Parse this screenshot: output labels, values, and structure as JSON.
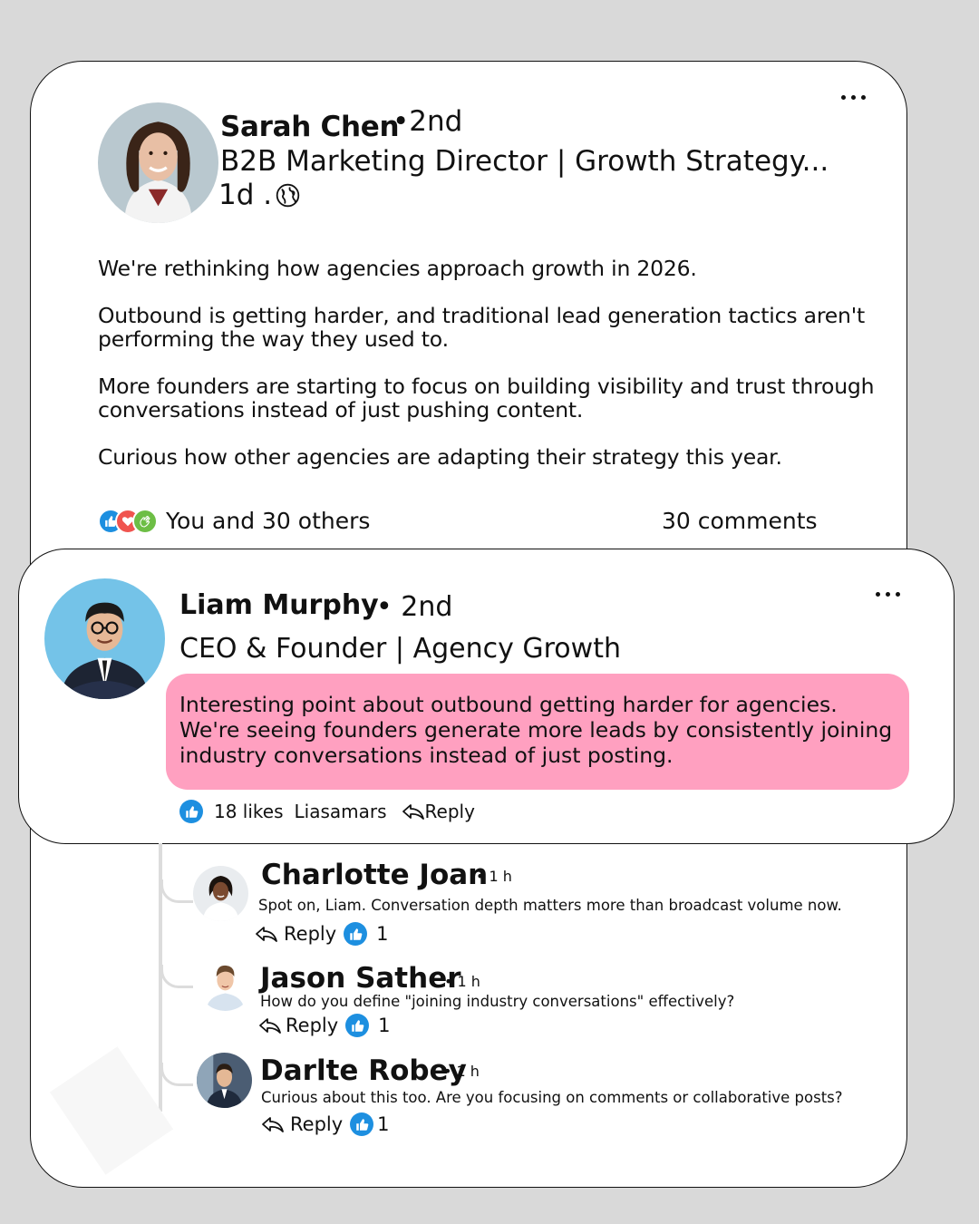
{
  "post": {
    "author_name": "Sarah Chen",
    "degree": "•2nd",
    "headline": "B2B Marketing Director | Growth Strategy...",
    "time": "1d .",
    "body": [
      "We're rethinking how agencies approach growth in 2026.",
      "Outbound is getting harder, and traditional lead generation tactics aren't performing the way they used to.",
      "More founders are starting to focus on building visibility and trust through conversations instead of just pushing content.",
      "Curious how other agencies are adapting their strategy this year."
    ],
    "reactions_text": "You and 30 others",
    "comments_count": "30 comments",
    "reaction_icons": [
      "like-icon",
      "heart-icon",
      "clap-icon"
    ]
  },
  "top_comment": {
    "author_name": "Liam Murphy",
    "degree": "• 2nd",
    "headline": "CEO & Founder | Agency Growth",
    "text": "Interesting point about outbound getting harder for agencies. We're seeing founders generate more leads by consistently joining industry conversations instead of just posting.",
    "likes": "18 likes",
    "liker": "Liasamars",
    "reply_label": "Reply",
    "bubble_color": "#ffa0c0"
  },
  "replies": [
    {
      "author_name": "Charlotte Joan",
      "time": "• 1 h",
      "text": "Spot on, Liam. Conversation depth matters more than broadcast volume now.",
      "reply_label": "Reply",
      "likes": "1"
    },
    {
      "author_name": "Jason Sather",
      "time": "• 1 h",
      "text": "How do you define \"joining industry conversations\" effectively?",
      "reply_label": "Reply",
      "likes": "1"
    },
    {
      "author_name": "Darlte Robey",
      "time": "• 1 h",
      "text": "Curious about this too. Are you focusing on comments or collaborative posts?",
      "reply_label": "Reply",
      "likes": "1"
    }
  ],
  "colors": {
    "like_blue": "#1d8fe0",
    "heart_red": "#f0544f",
    "clap_green": "#6dbe45",
    "background": "#d9d9d9"
  }
}
